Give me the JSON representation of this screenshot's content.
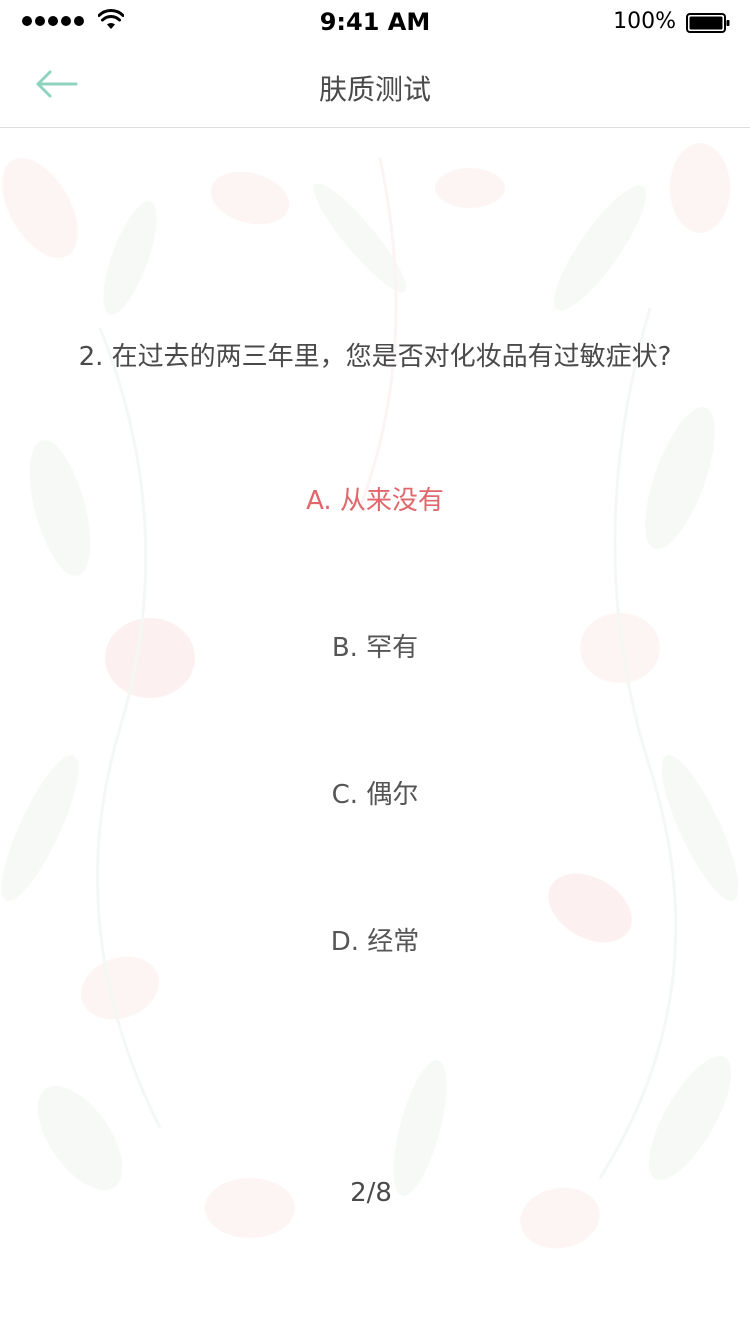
{
  "status_bar": {
    "time": "9:41 AM",
    "battery_percent": "100%",
    "signal_bars": 5
  },
  "nav": {
    "title": "肤质测试",
    "back_icon": "back-arrow-icon"
  },
  "quiz": {
    "question": "2. 在过去的两三年里，您是否对化妆品有过敏症状?",
    "options": [
      {
        "label": "A. 从来没有",
        "selected": true
      },
      {
        "label": "B. 罕有",
        "selected": false
      },
      {
        "label": "C. 偶尔",
        "selected": false
      },
      {
        "label": "D. 经常",
        "selected": false
      }
    ],
    "progress": "2/8"
  },
  "colors": {
    "accent_selected": "#e0676b",
    "back_arrow": "#8fd3bf",
    "floral_pink": "#f4c4c0",
    "floral_green": "#cfe0d3"
  }
}
